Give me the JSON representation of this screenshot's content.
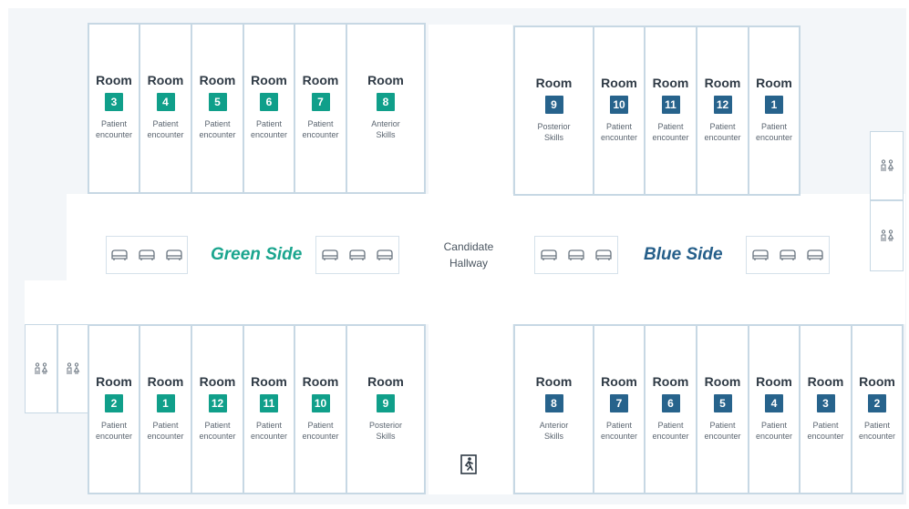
{
  "green_side": {
    "label": "Green Side",
    "color": "#109f8a",
    "top_rooms": [
      {
        "title": "Room",
        "number": "3",
        "desc1": "Patient",
        "desc2": "encounter"
      },
      {
        "title": "Room",
        "number": "4",
        "desc1": "Patient",
        "desc2": "encounter"
      },
      {
        "title": "Room",
        "number": "5",
        "desc1": "Patient",
        "desc2": "encounter"
      },
      {
        "title": "Room",
        "number": "6",
        "desc1": "Patient",
        "desc2": "encounter"
      },
      {
        "title": "Room",
        "number": "7",
        "desc1": "Patient",
        "desc2": "encounter"
      },
      {
        "title": "Room",
        "number": "8",
        "desc1": "Anterior",
        "desc2": "Skills"
      }
    ],
    "bottom_rooms": [
      {
        "title": "Room",
        "number": "2",
        "desc1": "Patient",
        "desc2": "encounter"
      },
      {
        "title": "Room",
        "number": "1",
        "desc1": "Patient",
        "desc2": "encounter"
      },
      {
        "title": "Room",
        "number": "12",
        "desc1": "Patient",
        "desc2": "encounter"
      },
      {
        "title": "Room",
        "number": "11",
        "desc1": "Patient",
        "desc2": "encounter"
      },
      {
        "title": "Room",
        "number": "10",
        "desc1": "Patient",
        "desc2": "encounter"
      },
      {
        "title": "Room",
        "number": "9",
        "desc1": "Posterior",
        "desc2": "Skills"
      }
    ]
  },
  "blue_side": {
    "label": "Blue Side",
    "color": "#27638c",
    "top_rooms": [
      {
        "title": "Room",
        "number": "9",
        "desc1": "Posterior",
        "desc2": "Skills"
      },
      {
        "title": "Room",
        "number": "10",
        "desc1": "Patient",
        "desc2": "encounter"
      },
      {
        "title": "Room",
        "number": "11",
        "desc1": "Patient",
        "desc2": "encounter"
      },
      {
        "title": "Room",
        "number": "12",
        "desc1": "Patient",
        "desc2": "encounter"
      },
      {
        "title": "Room",
        "number": "1",
        "desc1": "Patient",
        "desc2": "encounter"
      }
    ],
    "bottom_rooms": [
      {
        "title": "Room",
        "number": "8",
        "desc1": "Anterior",
        "desc2": "Skills"
      },
      {
        "title": "Room",
        "number": "7",
        "desc1": "Patient",
        "desc2": "encounter"
      },
      {
        "title": "Room",
        "number": "6",
        "desc1": "Patient",
        "desc2": "encounter"
      },
      {
        "title": "Room",
        "number": "5",
        "desc1": "Patient",
        "desc2": "encounter"
      },
      {
        "title": "Room",
        "number": "4",
        "desc1": "Patient",
        "desc2": "encounter"
      },
      {
        "title": "Room",
        "number": "3",
        "desc1": "Patient",
        "desc2": "encounter"
      },
      {
        "title": "Room",
        "number": "2",
        "desc1": "Patient",
        "desc2": "encounter"
      }
    ]
  },
  "hallway": {
    "line1": "Candidate",
    "line2": "Hallway"
  },
  "icons": {
    "seating": "bench-icon",
    "restroom": "restroom-icon",
    "exit": "emergency-exit-icon"
  }
}
